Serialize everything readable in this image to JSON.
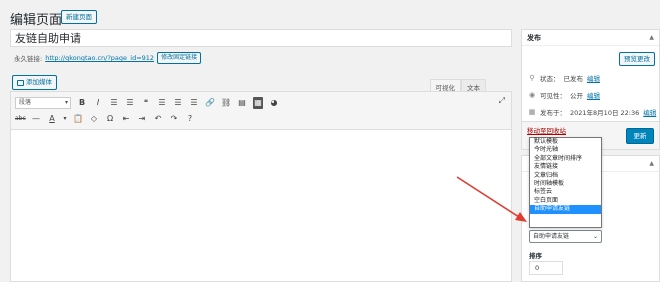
{
  "header": {
    "page_title": "编辑页面",
    "add_new_label": "新建页面"
  },
  "post": {
    "title": "友链自助申请"
  },
  "permalink": {
    "label": "永久链接:",
    "url": "http://qkongtao.cn/?page_id=912",
    "button_label": "修改固定链接"
  },
  "media": {
    "add_media_label": "添加媒体"
  },
  "editor": {
    "tabs": [
      "可视化",
      "文本"
    ],
    "active_tab": "可视化",
    "format_select": "段落",
    "toolbar_row1": [
      "B",
      "I",
      "☰",
      "☰",
      "❝",
      "☰",
      "☰",
      "☰",
      "🔗",
      "⛓",
      "▤",
      "▦",
      "◕"
    ],
    "toolbar_row2": [
      "abc",
      "—",
      "A",
      "▾",
      "📋",
      "◇",
      "Ω",
      "⇤",
      "⇥",
      "↶",
      "↷",
      "?"
    ],
    "fullscreen_icon": "fullscreen-icon"
  },
  "publish": {
    "title": "发布",
    "preview_label": "预览更改",
    "status_label": "状态：",
    "status_value": "已发布",
    "visibility_label": "可见性：",
    "visibility_value": "公开",
    "date_label": "发布于：",
    "date_value": "2021年8月10日 22:36",
    "edit_link": "编辑",
    "trash_label": "移动至回收站",
    "update_label": "更新"
  },
  "attributes": {
    "template_selected": "自助申请友链",
    "template_options": [
      "默认模板",
      "今时光轴",
      "全部文章时间排序",
      "友情链接",
      "文章归档",
      "时间轴模板",
      "标签云",
      "空白页面",
      "自助申请友链"
    ],
    "highlighted_index": 8,
    "order_label": "排序",
    "order_value": "0"
  },
  "colors": {
    "accent": "#0073aa",
    "primary": "#0085ba",
    "arrow": "#e03c31",
    "highlight": "#1e90ff"
  }
}
